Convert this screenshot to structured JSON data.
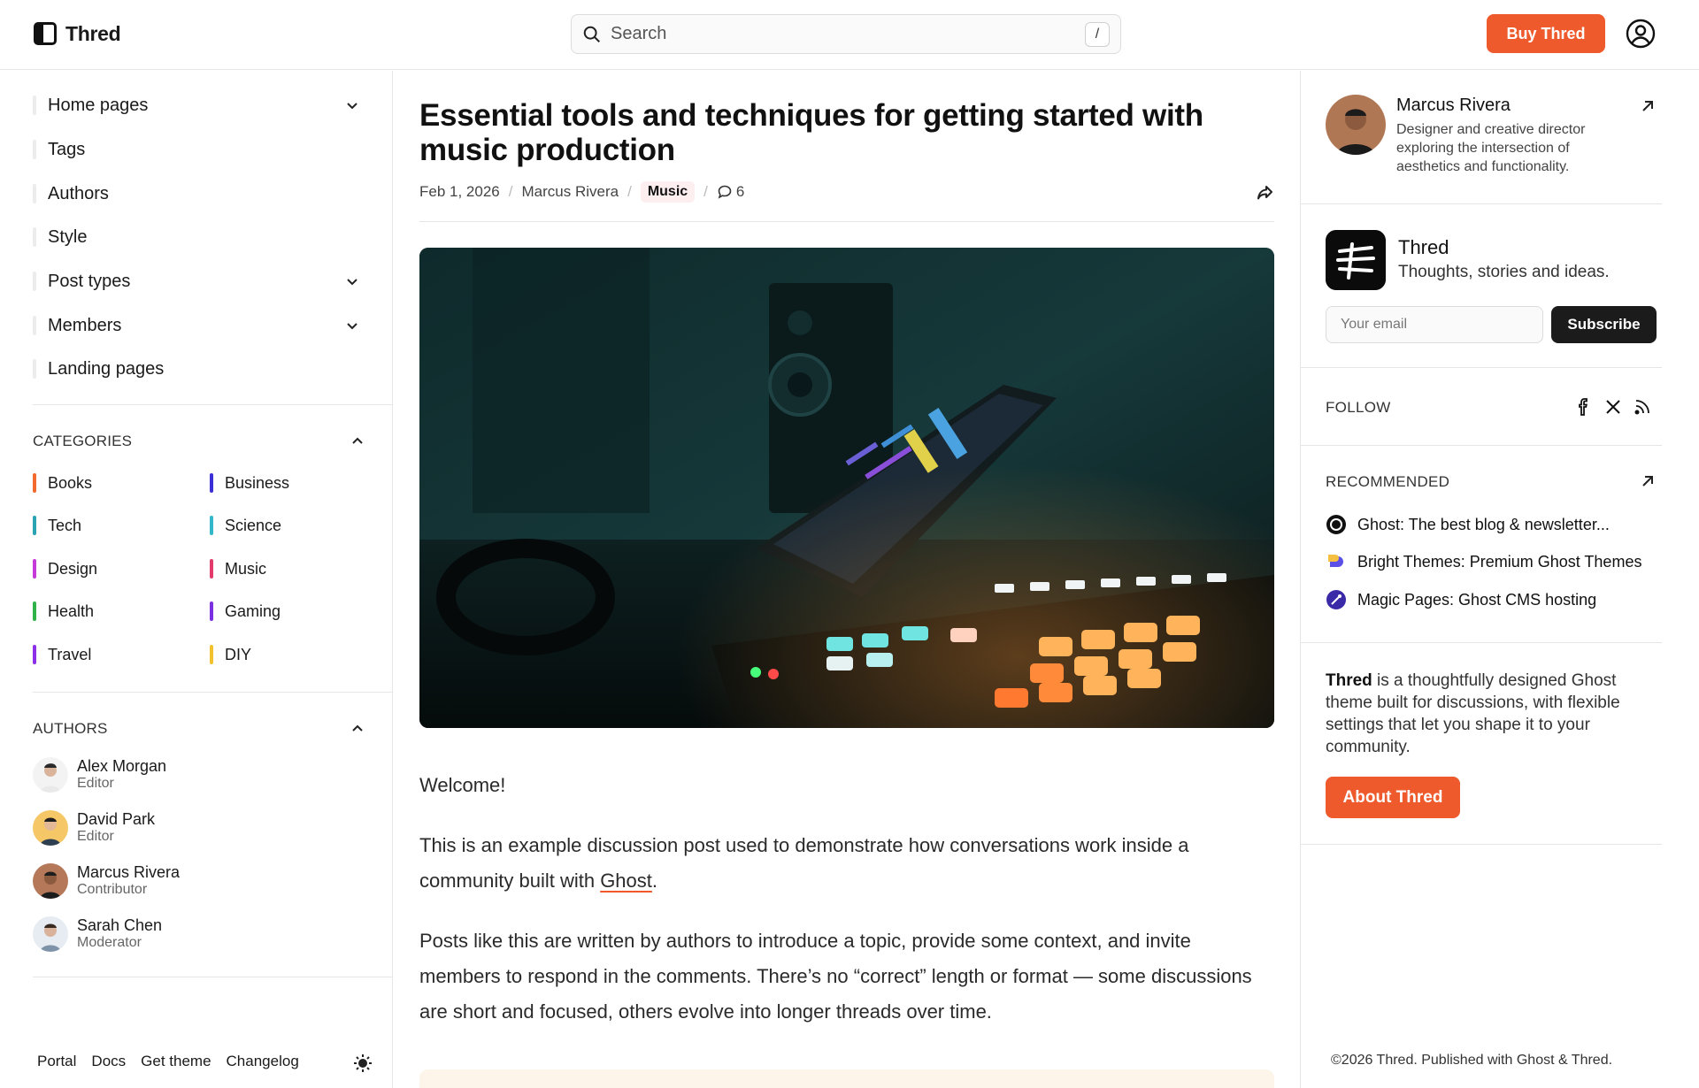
{
  "header": {
    "logo_text": "Thred",
    "search_placeholder": "Search",
    "search_shortcut": "/",
    "buy_label": "Buy Thred"
  },
  "sidebar": {
    "nav": [
      {
        "label": "Home pages",
        "expandable": true
      },
      {
        "label": "Tags",
        "expandable": false
      },
      {
        "label": "Authors",
        "expandable": false
      },
      {
        "label": "Style",
        "expandable": false
      },
      {
        "label": "Post types",
        "expandable": true
      },
      {
        "label": "Members",
        "expandable": true
      },
      {
        "label": "Landing pages",
        "expandable": false
      }
    ],
    "categories_title": "CATEGORIES",
    "categories": [
      {
        "label": "Books",
        "color": "#f26a2e"
      },
      {
        "label": "Business",
        "color": "#3b2fd6"
      },
      {
        "label": "Tech",
        "color": "#2aa3b5"
      },
      {
        "label": "Science",
        "color": "#34b8c9"
      },
      {
        "label": "Design",
        "color": "#c53ad9"
      },
      {
        "label": "Music",
        "color": "#e23a6b"
      },
      {
        "label": "Health",
        "color": "#2fb24a"
      },
      {
        "label": "Gaming",
        "color": "#7a2fe0"
      },
      {
        "label": "Travel",
        "color": "#8e2fe8"
      },
      {
        "label": "DIY",
        "color": "#f2c12e"
      }
    ],
    "authors_title": "AUTHORS",
    "authors": [
      {
        "name": "Alex Morgan",
        "role": "Editor"
      },
      {
        "name": "David Park",
        "role": "Editor"
      },
      {
        "name": "Marcus Rivera",
        "role": "Contributor"
      },
      {
        "name": "Sarah Chen",
        "role": "Moderator"
      }
    ],
    "footer_links": [
      "Portal",
      "Docs",
      "Get theme",
      "Changelog"
    ]
  },
  "post": {
    "title": "Essential tools and techniques for getting started with music production",
    "date": "Feb 1, 2026",
    "author": "Marcus Rivera",
    "tag": "Music",
    "comment_count": "6",
    "welcome": "Welcome!",
    "para1_before": "This is an example discussion post used to demonstrate how conversations work inside a community built with ",
    "para1_link": "Ghost",
    "para1_after": ".",
    "para2": "Posts like this are written by authors to introduce a topic, provide some context, and invite members to respond in the comments. There’s no “correct” length or format — some discussions are short and focused, others evolve into longer threads over time."
  },
  "right": {
    "author_name": "Marcus Rivera",
    "author_bio": "Designer and creative director exploring the intersection of aesthetics and functionality.",
    "pub_name": "Thred",
    "pub_desc": "Thoughts, stories and ideas.",
    "email_placeholder": "Your email",
    "subscribe_label": "Subscribe",
    "follow_label": "FOLLOW",
    "recommended_label": "RECOMMENDED",
    "recommended": [
      {
        "label": "Ghost: The best blog & newsletter...",
        "icon": "ghost-icon"
      },
      {
        "label": "Bright Themes: Premium Ghost Themes",
        "icon": "bright-themes-icon"
      },
      {
        "label": "Magic Pages: Ghost CMS hosting",
        "icon": "magic-pages-icon"
      }
    ],
    "about_brand": "Thred",
    "about_rest": " is a thoughtfully designed Ghost theme built for discussions, with flexible settings that let you shape it to your community.",
    "about_button": "About Thred",
    "copyright": "©2026 Thred. Published with Ghost & Thred."
  },
  "colors": {
    "accent": "#ee5a2c",
    "dark": "#1b1b1b"
  }
}
